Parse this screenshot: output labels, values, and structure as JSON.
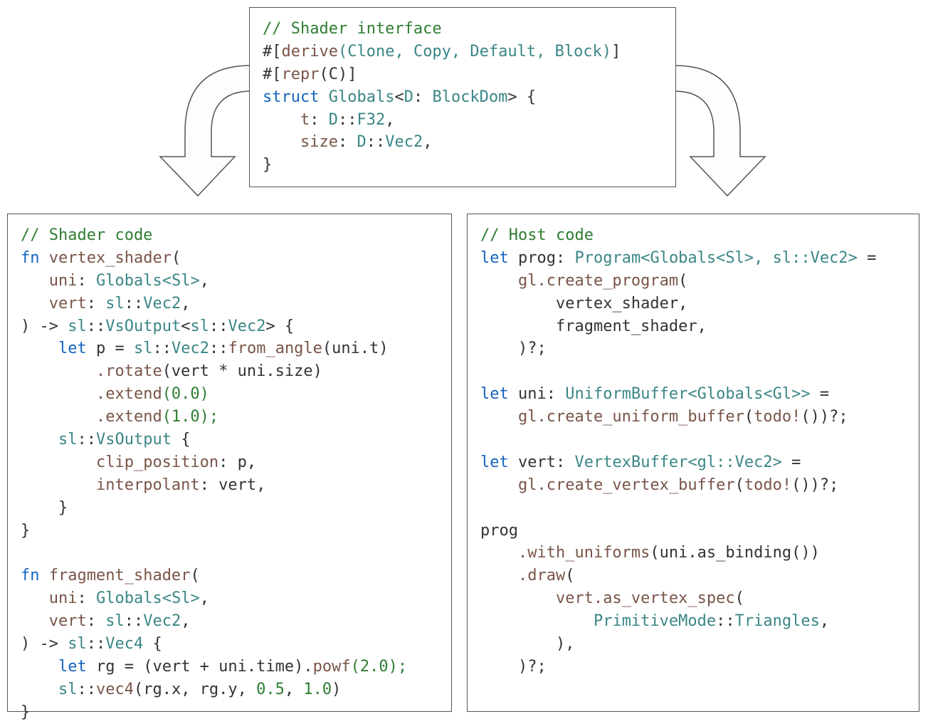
{
  "top": {
    "comment": "// Shader interface",
    "derive_open": "#[",
    "derive_word": "derive",
    "derive_args": "(Clone, Copy, Default, Block)",
    "derive_close": "]",
    "repr_open": "#[",
    "repr_word": "repr",
    "repr_arg": "(C)",
    "repr_close": "]",
    "struct_kw": "struct",
    "struct_name": "Globals",
    "struct_gen_open": "<",
    "struct_gen_param": "D",
    "struct_gen_colon": ": ",
    "struct_gen_bound": "BlockDom",
    "struct_gen_close": ">",
    "open_brace": " {",
    "field_t_name": "t",
    "field_t_colon": ": ",
    "field_t_type_prefix": "D",
    "field_t_type_sep": "::",
    "field_t_type": "F32",
    "field_t_comma": ",",
    "field_size_name": "size",
    "field_size_colon": ": ",
    "field_size_type_prefix": "D",
    "field_size_type_sep": "::",
    "field_size_type": "Vec2",
    "field_size_comma": ",",
    "close_brace": "}"
  },
  "left": {
    "comment": "// Shader code",
    "fn1_kw": "fn",
    "fn1_name": "vertex_shader",
    "fn1_open": "(",
    "fn1_p1_name": "uni",
    "fn1_p1_colon": ": ",
    "fn1_p1_type": "Globals",
    "fn1_p1_gen": "<Sl>",
    "fn1_p1_comma": ",",
    "fn1_p2_name": "vert",
    "fn1_p2_colon": ": ",
    "fn1_p2_ns": "sl",
    "fn1_p2_sep": "::",
    "fn1_p2_type": "Vec2",
    "fn1_p2_comma": ",",
    "fn1_close": ")",
    "fn1_arrow": " -> ",
    "fn1_ret_ns": "sl",
    "fn1_ret_sep": "::",
    "fn1_ret_type": "VsOutput",
    "fn1_ret_gen_open": "<",
    "fn1_ret_gen_ns": "sl",
    "fn1_ret_gen_sep": "::",
    "fn1_ret_gen_type": "Vec2",
    "fn1_ret_gen_close": ">",
    "fn1_brace": " {",
    "fn1_let": "let",
    "fn1_let_var": " p ",
    "fn1_let_eq": "= ",
    "fn1_let_ns": "sl",
    "fn1_let_sep": "::",
    "fn1_let_type": "Vec2",
    "fn1_let_sep2": "::",
    "fn1_let_fn": "from_angle",
    "fn1_let_arg": "(uni.t)",
    "fn1_rotate": ".rotate",
    "fn1_rotate_arg": "(vert * uni.size)",
    "fn1_extend1": ".extend",
    "fn1_extend1_num": "(0.0)",
    "fn1_extend2": ".extend",
    "fn1_extend2_num": "(1.0);",
    "fn1_out_ns": "sl",
    "fn1_out_sep": "::",
    "fn1_out_type": "VsOutput",
    "fn1_out_brace": " {",
    "fn1_clip_name": "clip_position",
    "fn1_clip_colon": ": ",
    "fn1_clip_val": "p",
    "fn1_clip_comma": ",",
    "fn1_interp_name": "interpolant",
    "fn1_interp_colon": ": ",
    "fn1_interp_val": "vert",
    "fn1_interp_comma": ",",
    "fn1_close_inner": "}",
    "fn1_close_outer": "}",
    "fn2_kw": "fn",
    "fn2_name": "fragment_shader",
    "fn2_open": "(",
    "fn2_p1_name": "uni",
    "fn2_p1_colon": ": ",
    "fn2_p1_type": "Globals",
    "fn2_p1_gen": "<Sl>",
    "fn2_p1_comma": ",",
    "fn2_p2_name": "vert",
    "fn2_p2_colon": ": ",
    "fn2_p2_ns": "sl",
    "fn2_p2_sep": "::",
    "fn2_p2_type": "Vec2",
    "fn2_p2_comma": ",",
    "fn2_close": ")",
    "fn2_arrow": " -> ",
    "fn2_ret_ns": "sl",
    "fn2_ret_sep": "::",
    "fn2_ret_type": "Vec4",
    "fn2_brace": " {",
    "fn2_let": "let",
    "fn2_let_var": " rg ",
    "fn2_let_eq": "= (vert + uni.time).",
    "fn2_powf": "powf",
    "fn2_powf_num": "(2.0);",
    "fn2_v4_ns": "sl",
    "fn2_v4_sep": "::",
    "fn2_v4_fn": "vec4",
    "fn2_v4_args": "(rg.x, rg.y, ",
    "fn2_v4_n1": "0.5",
    "fn2_v4_c1": ", ",
    "fn2_v4_n2": "1.0",
    "fn2_v4_c2": ")",
    "fn2_close_outer": "}"
  },
  "right": {
    "comment": "// Host code",
    "l1_let": "let",
    "l1_var": " prog",
    "l1_colon": ": ",
    "l1_type": "Program",
    "l1_gen": "<Globals<Sl>, sl::Vec2>",
    "l1_eq": " =",
    "l1_call": "gl.create_program",
    "l1_open": "(",
    "l1_a1": "vertex_shader",
    "l1_c1": ",",
    "l1_a2": "fragment_shader",
    "l1_c2": ",",
    "l1_close": ")?;",
    "l2_let": "let",
    "l2_var": " uni",
    "l2_colon": ": ",
    "l2_type": "UniformBuffer",
    "l2_gen": "<Globals<Gl>>",
    "l2_eq": " =",
    "l2_call": "gl.create_uniform_buffer",
    "l2_open": "(",
    "l2_todo": "todo!",
    "l2_todo_arg": "()",
    "l2_close": ")?;",
    "l3_let": "let",
    "l3_var": " vert",
    "l3_colon": ": ",
    "l3_type": "VertexBuffer",
    "l3_gen": "<gl::Vec2>",
    "l3_eq": " =",
    "l3_call": "gl.create_vertex_buffer",
    "l3_open": "(",
    "l3_todo": "todo!",
    "l3_todo_arg": "()",
    "l3_close": ")?;",
    "l4_prog": "prog",
    "l4_with": ".with_uniforms",
    "l4_with_arg": "(uni.as_binding())",
    "l4_draw": ".draw",
    "l4_draw_open": "(",
    "l4_vert": "vert.as_vertex_spec",
    "l4_vert_open": "(",
    "l4_prim_type": "PrimitiveMode",
    "l4_prim_sep": "::",
    "l4_prim_val": "Triangles",
    "l4_prim_comma": ",",
    "l4_vert_close": "),",
    "l4_draw_close": ")?;"
  }
}
